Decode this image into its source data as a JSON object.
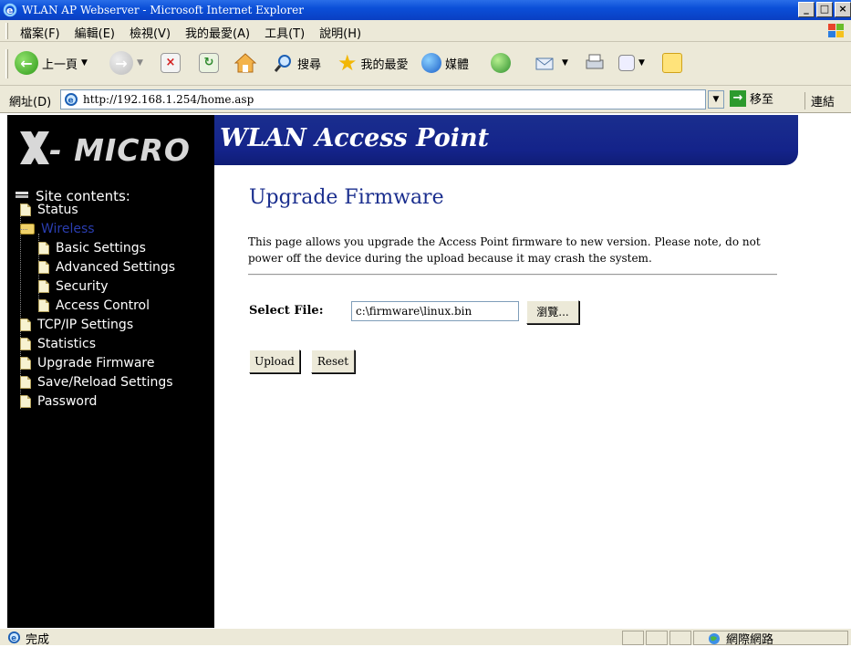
{
  "browser": {
    "window_title": "WLAN AP Webserver - Microsoft Internet Explorer",
    "window_buttons": [
      "_",
      "□",
      "×"
    ],
    "menu": [
      "檔案(F)",
      "編輯(E)",
      "檢視(V)",
      "我的最愛(A)",
      "工具(T)",
      "說明(H)"
    ],
    "toolbar": {
      "back_label": "上一頁",
      "search_label": "搜尋",
      "favorites_label": "我的最愛",
      "media_label": "媒體"
    },
    "address": {
      "label": "網址(D)",
      "url": "http://192.168.1.254/home.asp",
      "go_label": "移至",
      "links_label": "連結"
    },
    "status": {
      "text": "完成",
      "zone": "網際網路"
    }
  },
  "header": {
    "brand": "- MICRO",
    "brand_x": "X",
    "product": "WLAN Access Point"
  },
  "sidebar": {
    "title": "Site contents:",
    "items": [
      {
        "label": "Status",
        "type": "doc",
        "level": 0
      },
      {
        "label": "Wireless",
        "type": "folder",
        "level": 0
      },
      {
        "label": "Basic Settings",
        "type": "doc",
        "level": 1
      },
      {
        "label": "Advanced Settings",
        "type": "doc",
        "level": 1
      },
      {
        "label": "Security",
        "type": "doc",
        "level": 1
      },
      {
        "label": "Access Control",
        "type": "doc",
        "level": 1
      },
      {
        "label": "TCP/IP Settings",
        "type": "doc",
        "level": 0
      },
      {
        "label": "Statistics",
        "type": "doc",
        "level": 0
      },
      {
        "label": "Upgrade Firmware",
        "type": "doc",
        "level": 0
      },
      {
        "label": "Save/Reload Settings",
        "type": "doc",
        "level": 0
      },
      {
        "label": "Password",
        "type": "doc",
        "level": 0
      }
    ]
  },
  "main": {
    "heading": "Upgrade Firmware",
    "description": "This page allows you upgrade the Access Point firmware to new version. Please note, do not power off the device during the upload because it may crash the system.",
    "select_file_label": "Select File:",
    "file_value": "c:\\firmware\\linux.bin",
    "browse_label": "瀏覽...",
    "upload_label": "Upload",
    "reset_label": "Reset"
  },
  "colors": {
    "titlebar": "#0b4fd8",
    "header_band": "#14238a",
    "heading": "#1a2e8e",
    "sidebar_bg": "#000000",
    "sidebar_active": "#1a2e8e"
  }
}
